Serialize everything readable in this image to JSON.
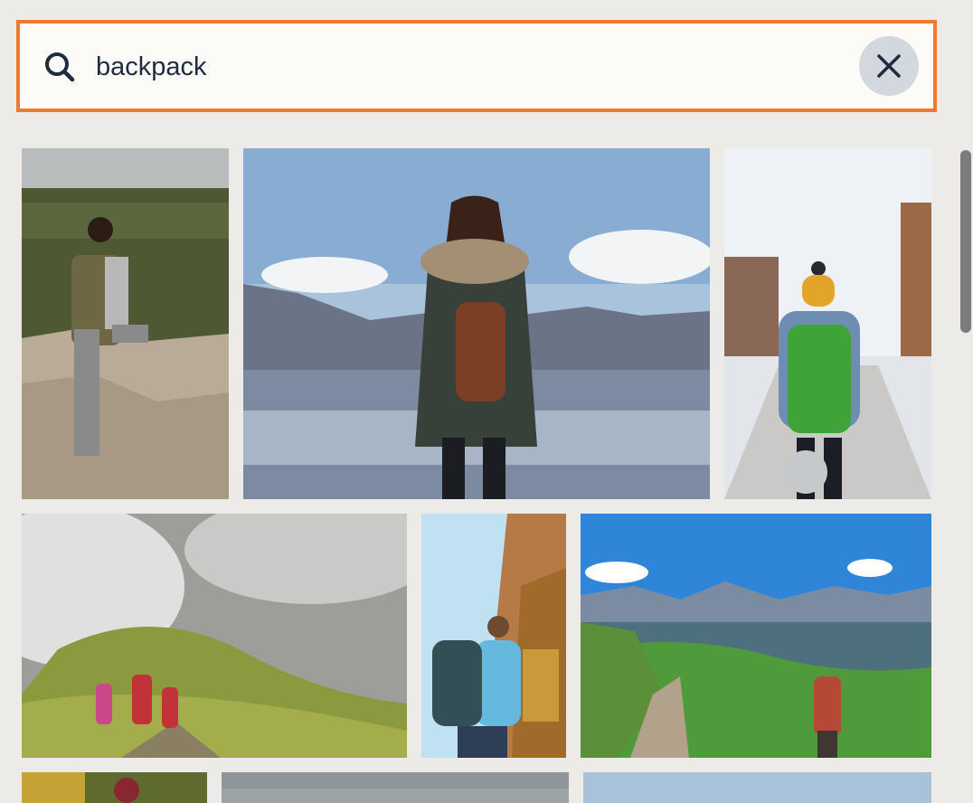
{
  "search": {
    "value": "backpack",
    "placeholder": "",
    "icon": "search-icon",
    "clear_icon": "close-icon"
  },
  "colors": {
    "focus_border": "#ef7a2b",
    "background": "#edebe8",
    "text": "#1f2b3e"
  },
  "results": [
    {
      "subject": "hiker-on-cliff"
    },
    {
      "subject": "woman-at-lake"
    },
    {
      "subject": "hiker-snowy-street"
    },
    {
      "subject": "group-hiking-fog"
    },
    {
      "subject": "hiker-canyon"
    },
    {
      "subject": "hiker-mountain-trail"
    },
    {
      "subject": "partial-photo-1"
    },
    {
      "subject": "partial-photo-2"
    },
    {
      "subject": "partial-photo-3"
    }
  ]
}
